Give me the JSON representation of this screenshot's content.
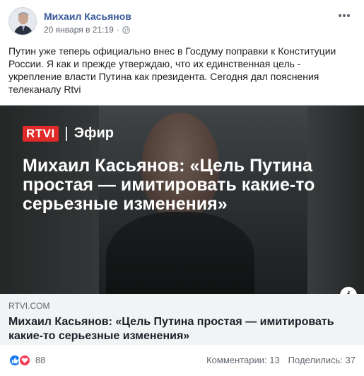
{
  "post": {
    "author": "Михаил Касьянов",
    "date": "20 января в 21:19",
    "separator": "·",
    "text": "Путин уже теперь официально внес в Госдуму поправки к Конституции России. Я как и прежде утверждаю, что их единственная цель - укрепление власти Путина как президента. Сегодня дал пояснения телеканалу Rtvi",
    "icons": {
      "privacy": "globe-icon",
      "more": "more-options-icon",
      "info": "info-icon"
    }
  },
  "preview": {
    "overlay_logo": "RTVI",
    "overlay_channel": "Эфир",
    "overlay_headline": "Михаил Касьянов: «Цель Путина простая — имитировать какие-то серьезные изменения»",
    "domain": "RTVI.COM",
    "title": "Михаил Касьянов: «Цель Путина простая — имитировать какие-то серьезные изменения»",
    "info_glyph": "i"
  },
  "footer": {
    "reactions_count": "88",
    "comments": "Комментарии: 13",
    "shares": "Поделились: 37",
    "reaction_icons": [
      "like-icon",
      "love-icon"
    ]
  },
  "colors": {
    "author_link": "#385898",
    "rtvi_red": "#e12a2a",
    "like_blue": "#1877f2",
    "love_red": "#f33e58",
    "caption_bg": "#f2f3f5"
  }
}
